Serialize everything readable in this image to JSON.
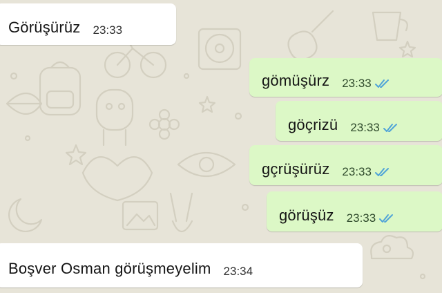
{
  "wallpaper": {
    "background_color": "#e7e4d8",
    "doodle_color": "#d3cfc0",
    "name": "chat-doodle-wallpaper"
  },
  "colors": {
    "incoming_bubble": "#ffffff",
    "outgoing_bubble": "#dcf8c6",
    "read_ticks": "#4fa3d8"
  },
  "messages": [
    {
      "direction": "incoming",
      "text": "Görüşürüz",
      "time": "23:33"
    },
    {
      "direction": "outgoing",
      "text": "gömüşürz",
      "time": "23:33",
      "status": "read-double-tick-icon"
    },
    {
      "direction": "outgoing",
      "text": "göçrizü",
      "time": "23:33",
      "status": "read-double-tick-icon"
    },
    {
      "direction": "outgoing",
      "text": "gçrüşürüz",
      "time": "23:33",
      "status": "read-double-tick-icon"
    },
    {
      "direction": "outgoing",
      "text": "görüşüz",
      "time": "23:33",
      "status": "read-double-tick-icon"
    },
    {
      "direction": "incoming",
      "text": "Boşver Osman görüşmeyelim",
      "time": "23:34"
    }
  ]
}
